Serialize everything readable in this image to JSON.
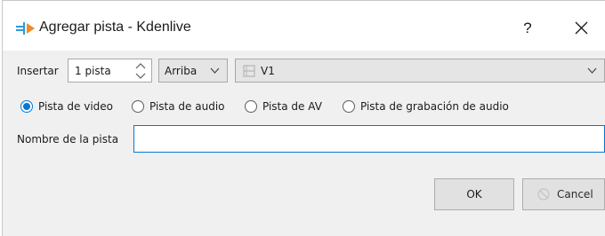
{
  "window": {
    "title": "Agregar pista - Kdenlive",
    "help_label": "?"
  },
  "insert": {
    "label": "Insertar",
    "count_value": "1 pista",
    "position_value": "Arriba",
    "track_value": "V1"
  },
  "track_types": [
    {
      "label": "Pista de video",
      "checked": true
    },
    {
      "label": "Pista de audio",
      "checked": false
    },
    {
      "label": "Pista de AV",
      "checked": false
    },
    {
      "label": "Pista de grabación de audio",
      "checked": false
    }
  ],
  "name_field": {
    "label": "Nombre de la pista",
    "value": ""
  },
  "buttons": {
    "ok_label": "OK",
    "cancel_label": "Cancel"
  },
  "colors": {
    "accent": "#0078d7",
    "app_icon_blue": "#2e9ad6",
    "app_icon_orange": "#f08a24"
  }
}
